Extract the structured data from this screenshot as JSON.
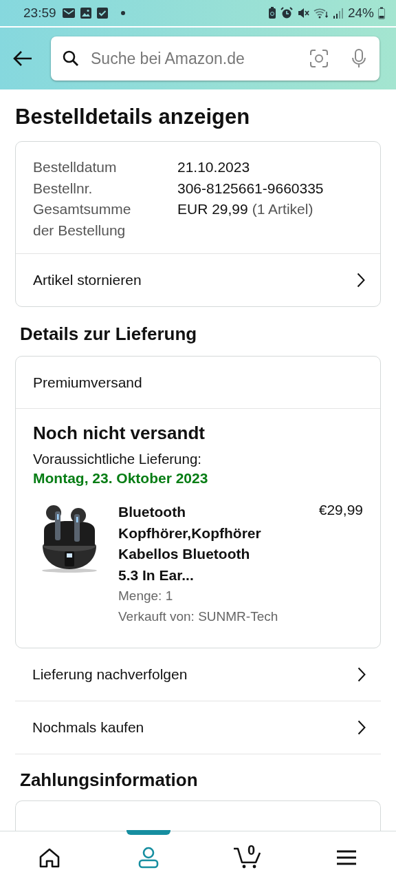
{
  "status_bar": {
    "time": "23:59",
    "battery": "24%"
  },
  "search": {
    "placeholder": "Suche bei Amazon.de"
  },
  "title": "Bestelldetails anzeigen",
  "order": {
    "fields": [
      {
        "label": "Bestelldatum",
        "value": "21.10.2023"
      },
      {
        "label": "Bestellnr.",
        "value": "306-8125661-9660335"
      },
      {
        "label": "Gesamtsumme der Bestellung",
        "value": "EUR 29,99",
        "note": "(1 Artikel)"
      }
    ],
    "action": "Artikel stornieren"
  },
  "delivery": {
    "heading": "Details zur Lieferung",
    "shipping": "Premiumversand",
    "status": "Noch nicht versandt",
    "expected_label": "Voraussichtliche Lieferung:",
    "expected_date": "Montag, 23. Oktober 2023",
    "item": {
      "kind": "picture",
      "title": "Bluetooth Kopfhörer,Kopfhörer Kabellos Bluetooth 5.3 In Ear...",
      "price": "€29,99",
      "quantity": "Menge: 1",
      "seller": "Verkauft von: SUNMR-Tech"
    }
  },
  "links": [
    "Lieferung nachverfolgen",
    "Nochmals kaufen"
  ],
  "payment": {
    "heading": "Zahlungsinformation"
  },
  "nav": [
    {
      "kind": "home",
      "selected": false
    },
    {
      "kind": "account",
      "selected": true
    },
    {
      "kind": "cart",
      "selected": false,
      "count": "0"
    },
    {
      "kind": "menu",
      "selected": false
    }
  ]
}
